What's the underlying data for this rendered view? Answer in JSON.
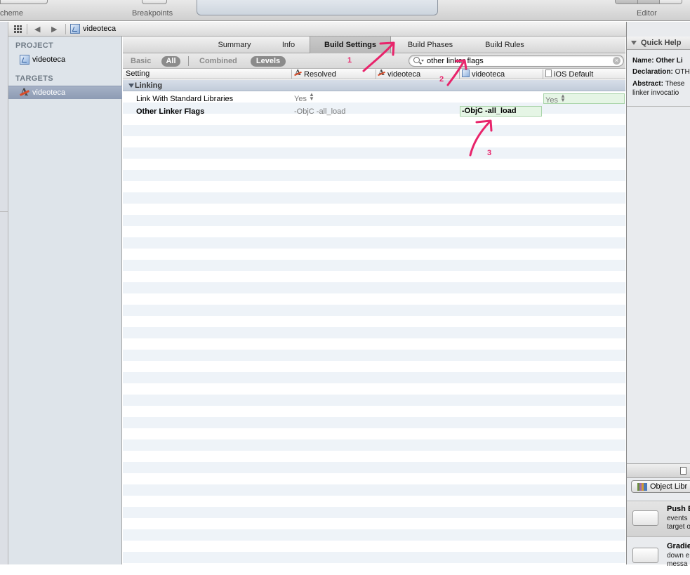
{
  "toolbar": {
    "scheme_label": "cheme",
    "breakpoints_label": "Breakpoints",
    "editor_label": "Editor"
  },
  "jumpbar": {
    "project_name": "videoteca"
  },
  "navigator": {
    "project_header": "PROJECT",
    "project_item": "videoteca",
    "targets_header": "TARGETS",
    "target_item": "videoteca"
  },
  "tabs": {
    "summary": "Summary",
    "info": "Info",
    "build_settings": "Build Settings",
    "build_phases": "Build Phases",
    "build_rules": "Build Rules"
  },
  "filters": {
    "basic": "Basic",
    "all": "All",
    "combined": "Combined",
    "levels": "Levels"
  },
  "search": {
    "value": "other linker flags"
  },
  "columns": {
    "setting": "Setting",
    "resolved": "Resolved",
    "target": "videoteca",
    "project": "videoteca",
    "ios_default": "iOS Default"
  },
  "group": {
    "name": "Linking"
  },
  "rows": [
    {
      "name": "Link With Standard Libraries",
      "resolved": "Yes",
      "ios_default": "Yes"
    },
    {
      "name": "Other Linker Flags",
      "resolved": "-ObjC -all_load",
      "project_value": "-ObjC -all_load"
    }
  ],
  "quick_help": {
    "header": "Quick Help",
    "name_label": "Name:",
    "name_value": "Other Li",
    "declaration_label": "Declaration:",
    "declaration_value": "OTH",
    "abstract_label": "Abstract:",
    "abstract_value": "These",
    "abstract_line2": "linker invocatio"
  },
  "library": {
    "popup_label": "Object Libr",
    "items": [
      {
        "title": "Push B",
        "desc1": "events",
        "desc2": "target o"
      },
      {
        "title": "Gradie",
        "desc1": "down e",
        "desc2": "messa"
      }
    ]
  },
  "annotations": {
    "one": "1",
    "two": "2",
    "three": "3",
    "color": "#e8246b"
  }
}
